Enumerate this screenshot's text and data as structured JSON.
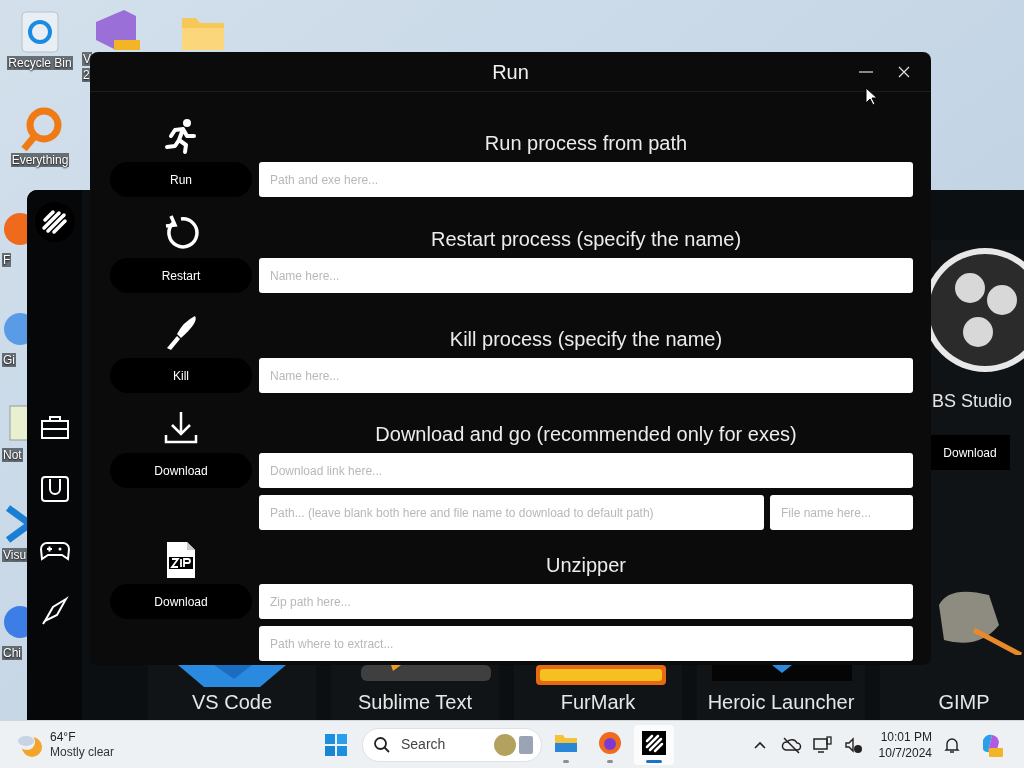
{
  "desktop_icons": [
    {
      "kind": "recycle",
      "lines": [
        "Recycle Bin"
      ]
    },
    {
      "kind": "studio",
      "lines": [
        "V",
        "2"
      ]
    },
    {
      "kind": "folder"
    },
    {
      "kind": "everything",
      "lines": [
        "Everything"
      ]
    },
    {
      "kind": "firefox",
      "lines": [
        "F"
      ]
    },
    {
      "kind": "google",
      "lines": [
        "Gi"
      ]
    },
    {
      "kind": "notepad",
      "lines": [
        "Not"
      ]
    },
    {
      "kind": "vscode",
      "lines": [
        "Visu"
      ]
    },
    {
      "kind": "chrome",
      "lines": [
        "Chi"
      ]
    }
  ],
  "app_window": {
    "featured": {
      "name": "BS Studio",
      "button": "Download"
    },
    "tiles": [
      {
        "kind": "vscode",
        "name": "VS Code"
      },
      {
        "kind": "sublime",
        "name": "Sublime Text"
      },
      {
        "kind": "furmark",
        "name": "FurMark"
      },
      {
        "kind": "heroic",
        "name": "Heroic Launcher"
      },
      {
        "kind": "gimp",
        "name": "GIMP"
      }
    ]
  },
  "run_window": {
    "title": "Run",
    "sections": [
      {
        "kind": "run",
        "heading": "Run process from path",
        "button": "Run",
        "field_rows": [
          [
            {
              "placeholder": "Path and exe here..."
            }
          ]
        ]
      },
      {
        "kind": "restart",
        "heading": "Restart process (specify the name)",
        "button": "Restart",
        "field_rows": [
          [
            {
              "placeholder": "Name here..."
            }
          ]
        ]
      },
      {
        "kind": "kill",
        "heading": "Kill process (specify the name)",
        "button": "Kill",
        "field_rows": [
          [
            {
              "placeholder": "Name here..."
            }
          ]
        ]
      },
      {
        "kind": "download",
        "heading": "Download and go (recommended only for exes)",
        "button": "Download",
        "field_rows": [
          [
            {
              "placeholder": "Download link here..."
            }
          ],
          [
            {
              "placeholder": "Path... (leave blank both here and file name to download to default path)"
            },
            {
              "placeholder": "File name here..."
            }
          ]
        ]
      },
      {
        "kind": "unzip",
        "heading": "Unzipper",
        "button": "Download",
        "field_rows": [
          [
            {
              "placeholder": "Zip path here..."
            }
          ],
          [
            {
              "placeholder": "Path where to extract..."
            }
          ]
        ]
      }
    ]
  },
  "taskbar": {
    "weather": {
      "temperature": "64°F",
      "condition": "Mostly clear"
    },
    "search": {
      "placeholder": "Search"
    },
    "apps": [
      {
        "kind": "explorer",
        "selected": false
      },
      {
        "kind": "firefox",
        "selected": false
      },
      {
        "kind": "toolbox",
        "selected": true
      }
    ],
    "clock": {
      "time": "10:01 PM",
      "date": "10/7/2024"
    }
  }
}
